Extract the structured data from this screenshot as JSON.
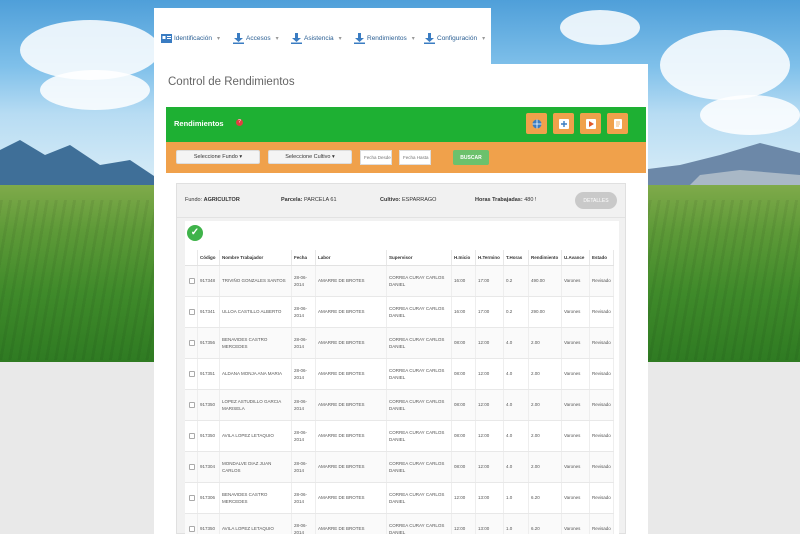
{
  "nav": {
    "items": [
      {
        "label": "Identificación",
        "icon": "id-card-icon"
      },
      {
        "label": "Accesos",
        "icon": "download-icon"
      },
      {
        "label": "Asistencia",
        "icon": "download-icon"
      },
      {
        "label": "Rendimientos",
        "icon": "download-icon"
      },
      {
        "label": "Configuración",
        "icon": "download-icon"
      }
    ],
    "chevron": "▾"
  },
  "page": {
    "title": "Control de Rendimientos"
  },
  "panel": {
    "title": "Rendimientos",
    "help": "?",
    "buttons": [
      "globe-icon",
      "add-icon",
      "export-icon",
      "document-icon"
    ]
  },
  "filters": {
    "fundo": "Seleccione Fundo ▾",
    "cultivo": "Seleccione Cultivo ▾",
    "fecha_desde_placeholder": "Fecha Desde",
    "fecha_hasta_placeholder": "Fecha Hasta",
    "buscar": "BUSCAR"
  },
  "info": {
    "fundo_label": "Fundo:",
    "fundo_value": "AGRICULTOR",
    "parcela_label": "Parcela:",
    "parcela_value": "PARCELA 61",
    "cultivo_label": "Cultivo:",
    "cultivo_value": "ESPARRAGO",
    "horas_label": "Horas Trabajadas:",
    "horas_value": "480 !",
    "detalles": "DETALLES"
  },
  "table": {
    "headers": [
      "",
      "Código",
      "Nombre Trabajador",
      "Fecha",
      "Labor",
      "Supervisor",
      "H.Inicio",
      "H.Termino",
      "T.Horas",
      "Rendimiento",
      "U.Avance",
      "Estado"
    ],
    "rows": [
      [
        "",
        "917348",
        "TRIVIÑO GONZALES SANTOS",
        "28-06-2014",
        "AMARRE DE BROTES",
        "CORREA CURAY CARLOS DANIEL",
        "16:00",
        "17:00",
        "0.2",
        "490.00",
        "Varones",
        "Revisado"
      ],
      [
        "",
        "917341",
        "ULLOA CASTILLO ALBERTO",
        "28-06-2014",
        "AMARRE DE BROTES",
        "CORREA CURAY CARLOS DANIEL",
        "16:00",
        "17:00",
        "0.2",
        "290.00",
        "Varones",
        "Revisado"
      ],
      [
        "",
        "917356",
        "BENAVIDES CASTRO MERCEDES",
        "28-06-2014",
        "AMARRE DE BROTES",
        "CORREA CURAY CARLOS DANIEL",
        "08:00",
        "12:00",
        "4.0",
        "2.00",
        "Varones",
        "Revisado"
      ],
      [
        "",
        "917351",
        "ALDANA MONJA ANA MARIA",
        "28-06-2014",
        "AMARRE DE BROTES",
        "CORREA CURAY CARLOS DANIEL",
        "08:00",
        "12:00",
        "4.0",
        "2.00",
        "Varones",
        "Revisado"
      ],
      [
        "",
        "917350",
        "LOPEZ ASTUDILLO GARCIA MARISELA",
        "28-06-2014",
        "AMARRE DE BROTES",
        "CORREA CURAY CARLOS DANIEL",
        "08:00",
        "12:00",
        "4.0",
        "2.00",
        "Varones",
        "Revisado"
      ],
      [
        "",
        "917350",
        "AVILA LOPEZ LETAQUIO",
        "28-06-2014",
        "AMARRE DE BROTES",
        "CORREA CURAY CARLOS DANIEL",
        "08:00",
        "12:00",
        "4.0",
        "2.00",
        "Varones",
        "Revisado"
      ],
      [
        "",
        "917304",
        "MONDALVE DIAZ JUAN CARLOS",
        "28-06-2014",
        "AMARRE DE BROTES",
        "CORREA CURAY CARLOS DANIEL",
        "08:00",
        "12:00",
        "4.0",
        "2.00",
        "Varones",
        "Revisado"
      ],
      [
        "",
        "917306",
        "BENAVIDES CASTRO MERCEDES",
        "28-06-2014",
        "AMARRE DE BROTES",
        "CORREA CURAY CARLOS DANIEL",
        "12:00",
        "13:00",
        "1.0",
        "6.20",
        "Varones",
        "Revisado"
      ],
      [
        "",
        "917350",
        "AVILA LOPEZ LETAQUIO",
        "28-06-2014",
        "AMARRE DE BROTES",
        "CORREA CURAY CARLOS DANIEL",
        "12:00",
        "13:00",
        "1.0",
        "6.20",
        "Varones",
        "Revisado"
      ]
    ]
  },
  "colors": {
    "green": "#1eb033",
    "orange": "#f0a14b",
    "nav_text": "#2b5f93"
  }
}
